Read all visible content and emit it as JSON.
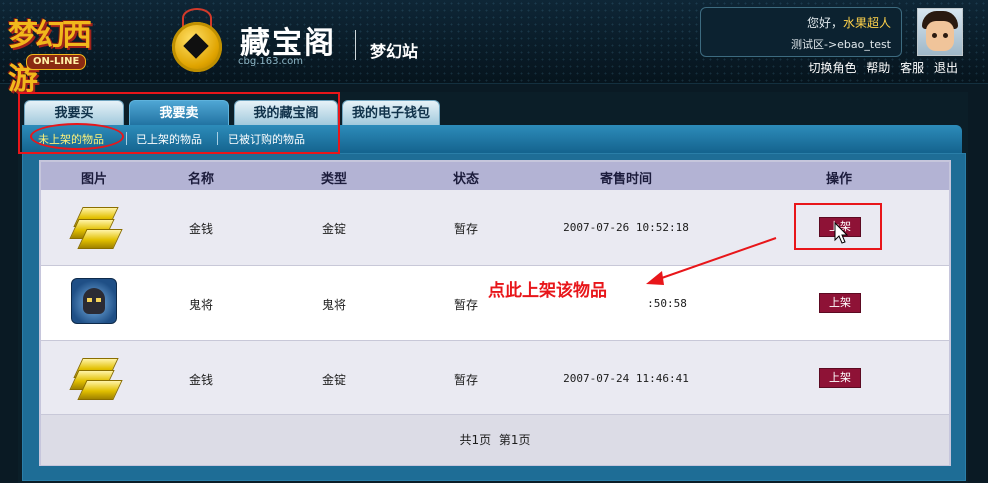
{
  "header": {
    "game_logo_text": "梦幻西游",
    "game_logo_sub": "ON-LINE",
    "brand_title": "藏宝阁",
    "brand_url": "cbg.163.com",
    "site_name": "梦幻站",
    "greeting_prefix": "您好，",
    "username": "水果超人",
    "server_label": "测试区->ebao_test",
    "links": [
      "切换角色",
      "帮助",
      "客服",
      "退出"
    ]
  },
  "tabs": {
    "buy": "我要买",
    "sell": "我要卖",
    "my_cbg": "我的藏宝阁",
    "wallet": "我的电子钱包"
  },
  "subtabs": {
    "unlisted": "未上架的物品",
    "listed": "已上架的物品",
    "ordered": "已被订购的物品"
  },
  "table": {
    "headers": {
      "image": "图片",
      "name": "名称",
      "type": "类型",
      "status": "状态",
      "time": "寄售时间",
      "action": "操作"
    },
    "rows": [
      {
        "icon": "gold-ingot-icon",
        "name": "金钱",
        "type": "金锭",
        "status": "暂存",
        "time": "2007-07-26 10:52:18",
        "action": "上架"
      },
      {
        "icon": "ghost-general-icon",
        "name": "鬼将",
        "type": "鬼将",
        "status": "暂存",
        "time": ":50:58",
        "action": "上架"
      },
      {
        "icon": "gold-ingot-icon",
        "name": "金钱",
        "type": "金锭",
        "status": "暂存",
        "time": "2007-07-24 11:46:41",
        "action": "上架"
      }
    ],
    "pager": {
      "total": "共1页",
      "current": "第1页"
    }
  },
  "annotation": {
    "callout": "点此上架该物品",
    "color": "#e8161a"
  },
  "colors": {
    "active_tab": "#1e6f9e",
    "list_button": "#8e1236",
    "table_header": "#b3b3d4"
  }
}
